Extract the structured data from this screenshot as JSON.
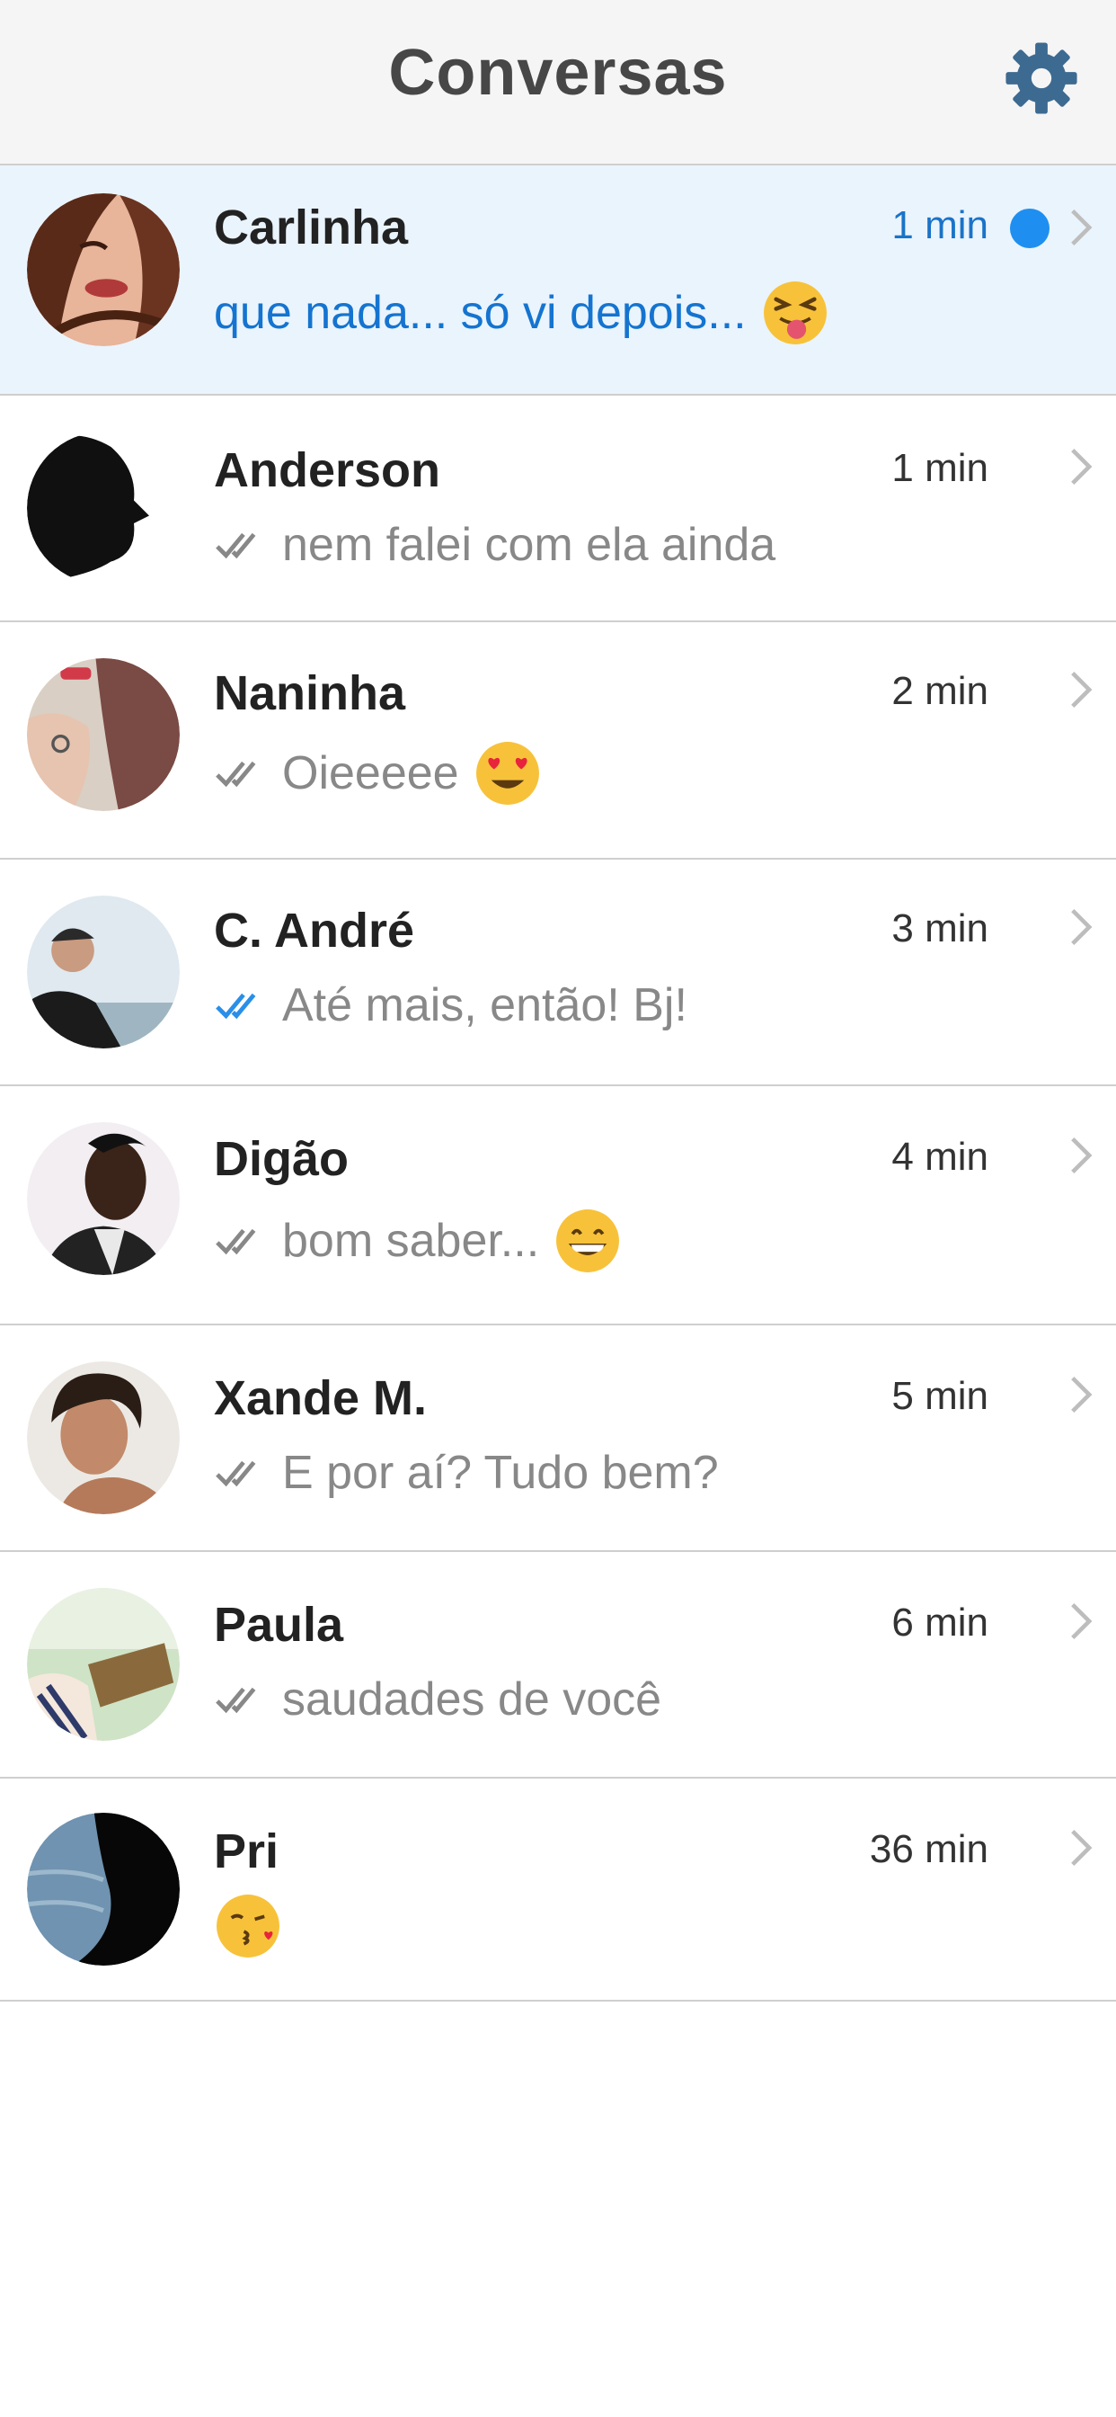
{
  "header": {
    "title": "Conversas",
    "settings_icon": "gear-icon"
  },
  "colors": {
    "accent": "#1e8ff0",
    "unread_bg": "#eaf4fd",
    "read_tick": "#888888",
    "delivered_tick": "#2a8fe8"
  },
  "conversations": [
    {
      "name": "Carlinha",
      "time": "1 min",
      "preview": "que nada... só vi depois...",
      "unread": true,
      "emoji": "tongue-squint-emoji",
      "tick": "none"
    },
    {
      "name": "Anderson",
      "time": "1 min",
      "preview": "nem falei com ela ainda",
      "unread": false,
      "emoji": "",
      "tick": "gray-double-check"
    },
    {
      "name": "Naninha",
      "time": "2 min",
      "preview": "Oieeeee",
      "unread": false,
      "emoji": "heart-eyes-emoji",
      "tick": "gray-double-check"
    },
    {
      "name": "C. André",
      "time": "3 min",
      "preview": "Até mais, então! Bj!",
      "unread": false,
      "emoji": "",
      "tick": "blue-double-check"
    },
    {
      "name": "Digão",
      "time": "4 min",
      "preview": "bom saber...",
      "unread": false,
      "emoji": "grinning-emoji",
      "tick": "gray-double-check"
    },
    {
      "name": "Xande M.",
      "time": "5 min",
      "preview": "E por aí? Tudo bem?",
      "unread": false,
      "emoji": "",
      "tick": "gray-double-check"
    },
    {
      "name": "Paula",
      "time": "6 min",
      "preview": "saudades de você",
      "unread": false,
      "emoji": "",
      "tick": "gray-double-check"
    },
    {
      "name": "Pri",
      "time": "36 min",
      "preview": "",
      "unread": false,
      "emoji": "kissing-heart-emoji",
      "tick": "none"
    }
  ]
}
